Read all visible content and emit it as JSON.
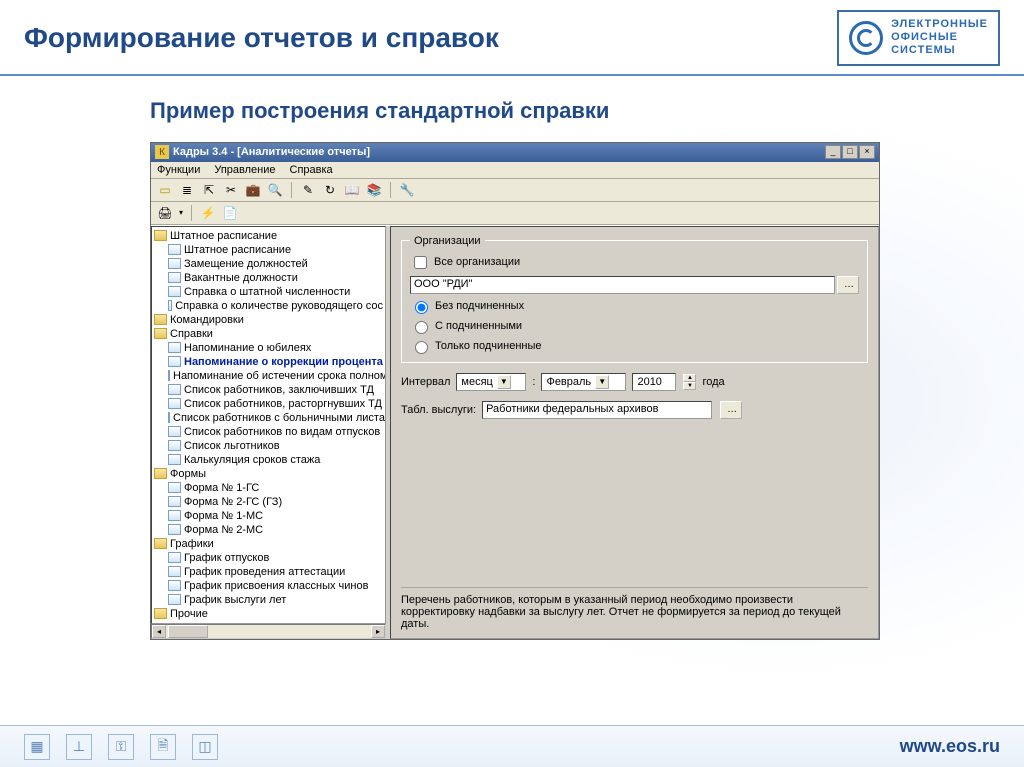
{
  "slide": {
    "title": "Формирование отчетов и справок",
    "subtitle": "Пример построения стандартной справки",
    "logo_lines": [
      "ЭЛЕКТРОННЫЕ",
      "ОФИСНЫЕ",
      "СИСТЕМЫ"
    ],
    "footer_url": "www.eos.ru"
  },
  "window": {
    "title": "Кадры 3.4 - [Аналитические отчеты]",
    "menus": [
      "Функции",
      "Управление",
      "Справка"
    ]
  },
  "tree": [
    {
      "type": "folder",
      "level": 0,
      "label": "Штатное расписание"
    },
    {
      "type": "file",
      "level": 1,
      "label": "Штатное расписание"
    },
    {
      "type": "file",
      "level": 1,
      "label": "Замещение должностей"
    },
    {
      "type": "file",
      "level": 1,
      "label": "Вакантные должности"
    },
    {
      "type": "file",
      "level": 1,
      "label": "Справка о штатной численности"
    },
    {
      "type": "file",
      "level": 1,
      "label": "Справка о количестве руководящего сос"
    },
    {
      "type": "folder",
      "level": 0,
      "label": "Командировки"
    },
    {
      "type": "folder",
      "level": 0,
      "label": "Справки"
    },
    {
      "type": "file",
      "level": 1,
      "label": "Напоминание о юбилеях"
    },
    {
      "type": "file",
      "level": 1,
      "label": "Напоминание о коррекции процента",
      "selected": true
    },
    {
      "type": "file",
      "level": 1,
      "label": "Напоминание об истечении срока полном"
    },
    {
      "type": "file",
      "level": 1,
      "label": "Список работников, заключивших ТД"
    },
    {
      "type": "file",
      "level": 1,
      "label": "Список работников, расторгнувших ТД"
    },
    {
      "type": "file",
      "level": 1,
      "label": "Список работников с больничными листа"
    },
    {
      "type": "file",
      "level": 1,
      "label": "Список работников по видам отпусков"
    },
    {
      "type": "file",
      "level": 1,
      "label": "Список льготников"
    },
    {
      "type": "file",
      "level": 1,
      "label": "Калькуляция сроков стажа"
    },
    {
      "type": "folder",
      "level": 0,
      "label": "Формы"
    },
    {
      "type": "file",
      "level": 1,
      "label": "Форма № 1-ГС"
    },
    {
      "type": "file",
      "level": 1,
      "label": "Форма № 2-ГС (ГЗ)"
    },
    {
      "type": "file",
      "level": 1,
      "label": "Форма № 1-МС"
    },
    {
      "type": "file",
      "level": 1,
      "label": "Форма № 2-МС"
    },
    {
      "type": "folder",
      "level": 0,
      "label": "Графики"
    },
    {
      "type": "file",
      "level": 1,
      "label": "График отпусков"
    },
    {
      "type": "file",
      "level": 1,
      "label": "График проведения аттестации"
    },
    {
      "type": "file",
      "level": 1,
      "label": "График присвоения классных чинов"
    },
    {
      "type": "file",
      "level": 1,
      "label": "График выслуги лет"
    },
    {
      "type": "folder",
      "level": 0,
      "label": "Прочие"
    }
  ],
  "form": {
    "org_legend": "Организации",
    "all_orgs_label": "Все организации",
    "org_value": "ООО \"РДИ\"",
    "radios": [
      "Без подчиненных",
      "С подчиненными",
      "Только подчиненные"
    ],
    "interval_label": "Интервал",
    "interval_unit": "месяц",
    "interval_sep": ":",
    "month": "Февраль",
    "year": "2010",
    "year_suffix": "года",
    "table_label": "Табл. выслуги:",
    "table_value": "Работники федеральных архивов",
    "info": "Перечень работников, которым в указанный период необходимо произвести корректировку надбавки за выслугу лет. Отчет не формируется за период до текущей даты."
  }
}
